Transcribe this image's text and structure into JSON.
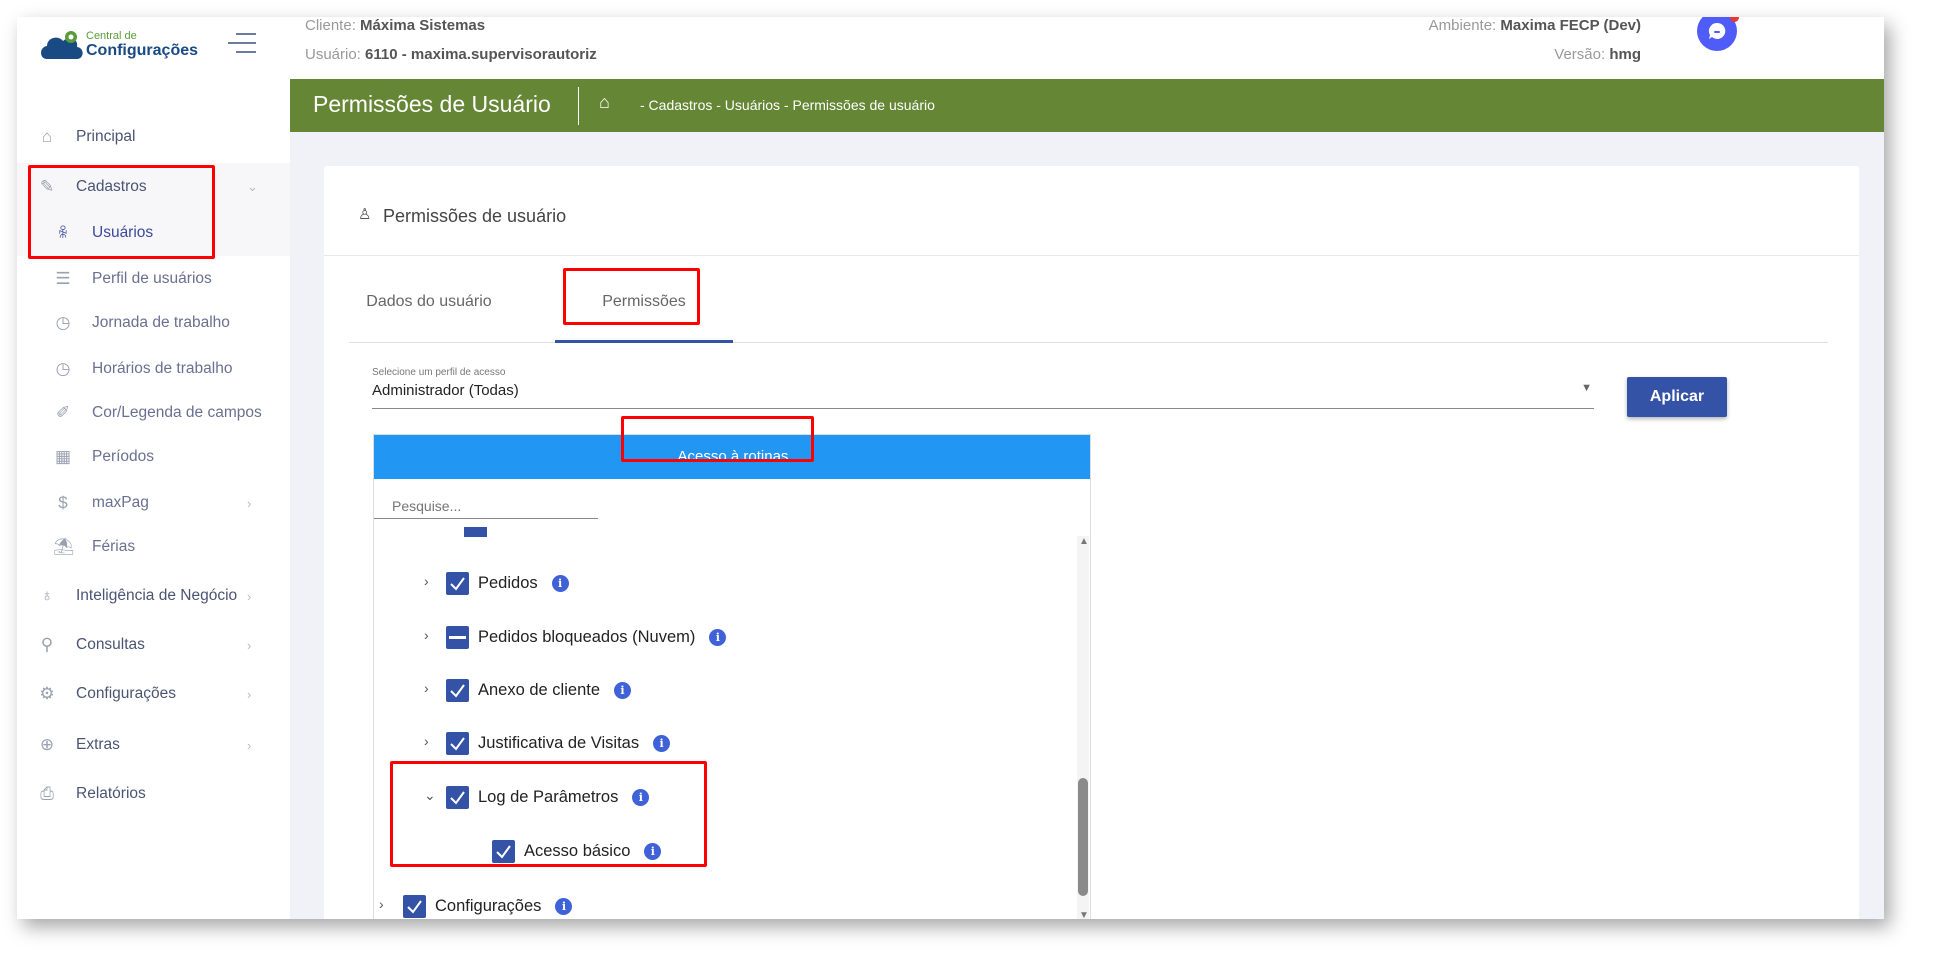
{
  "header": {
    "logo_small": "Central de",
    "logo_big": "Configurações",
    "cliente_label": "Cliente:",
    "cliente_value": "Máxima Sistemas",
    "usuario_label": "Usuário:",
    "usuario_value": "6110 - maxima.supervisorautoriz",
    "ambiente_label": "Ambiente:",
    "ambiente_value": "Maxima FECP (Dev)",
    "versao_label": "Versão:",
    "versao_value": "hmg"
  },
  "sidebar": {
    "items": [
      {
        "label": "Principal",
        "icon": "home-icon"
      },
      {
        "label": "Cadastros",
        "icon": "edit-icon"
      },
      {
        "label": "Usuários",
        "icon": "users-icon"
      },
      {
        "label": "Perfil de usuários",
        "icon": "checklist-icon"
      },
      {
        "label": "Jornada de trabalho",
        "icon": "clock-icon"
      },
      {
        "label": "Horários de trabalho",
        "icon": "clock-icon"
      },
      {
        "label": "Cor/Legenda de campos",
        "icon": "pencil-icon"
      },
      {
        "label": "Períodos",
        "icon": "calendar-icon"
      },
      {
        "label": "maxPag",
        "icon": "money-icon"
      },
      {
        "label": "Férias",
        "icon": "beach-umbrella-icon"
      },
      {
        "label": "Inteligência de Negócio",
        "icon": "lightbulb-icon"
      },
      {
        "label": "Consultas",
        "icon": "search-icon"
      },
      {
        "label": "Configurações",
        "icon": "gear-icon"
      },
      {
        "label": "Extras",
        "icon": "plus-circle-icon"
      },
      {
        "label": "Relatórios",
        "icon": "printer-icon"
      }
    ]
  },
  "page": {
    "title": "Permissões de Usuário",
    "breadcrumb": "- Cadastros - Usuários - Permissões de usuário"
  },
  "card": {
    "title": "Permissões de usuário"
  },
  "tabs": [
    {
      "label": "Dados do usuário"
    },
    {
      "label": "Permissões"
    }
  ],
  "profile_select": {
    "label": "Selecione um perfil de acesso",
    "value": "Administrador (Todas)"
  },
  "apply_label": "Aplicar",
  "panel": {
    "header": "Acesso à rotinas",
    "search_placeholder": "Pesquise..."
  },
  "tree": [
    {
      "label": "Pedidos",
      "state": "checked"
    },
    {
      "label": "Pedidos bloqueados (Nuvem)",
      "state": "partial"
    },
    {
      "label": "Anexo de cliente",
      "state": "checked"
    },
    {
      "label": "Justificativa de Visitas",
      "state": "checked"
    },
    {
      "label": "Log de Parâmetros",
      "state": "checked",
      "expanded": true
    },
    {
      "label": "Acesso básico",
      "state": "checked"
    },
    {
      "label": "Configurações",
      "state": "checked"
    }
  ],
  "colors": {
    "green": "#658634",
    "blue_panel": "#2196f3",
    "primary": "#3553a6",
    "highlight": "#ff0000"
  }
}
